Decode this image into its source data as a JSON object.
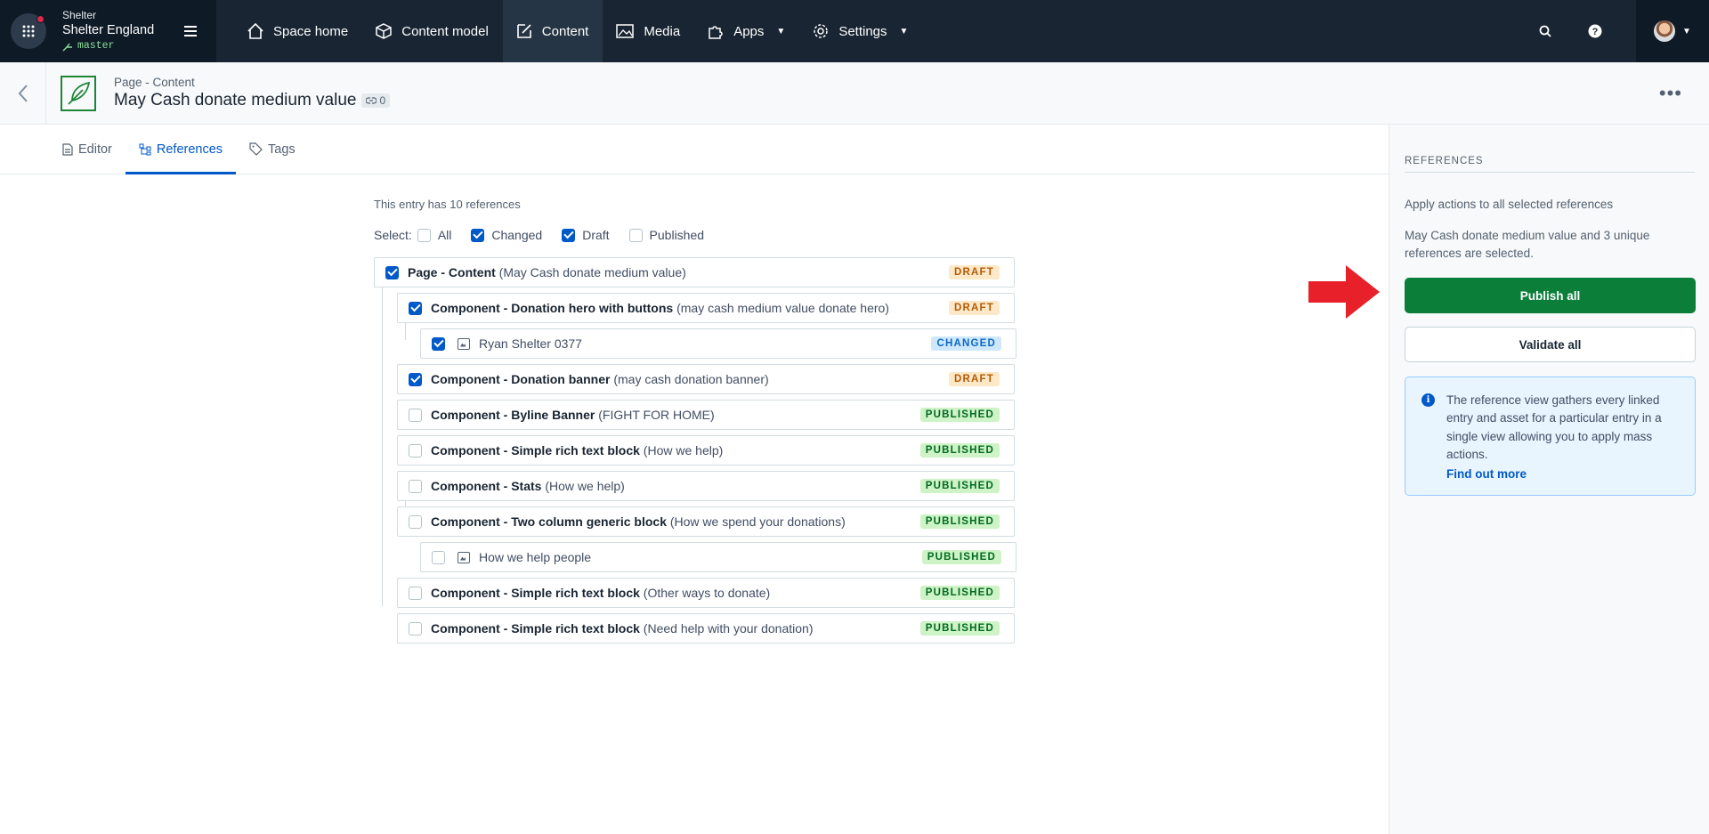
{
  "topnav": {
    "org": "Shelter",
    "space_name": "Shelter England",
    "environment": "master",
    "items": [
      {
        "label": "Space home",
        "icon": "home-icon"
      },
      {
        "label": "Content model",
        "icon": "cube-icon"
      },
      {
        "label": "Content",
        "icon": "pencil-icon",
        "active": true
      },
      {
        "label": "Media",
        "icon": "image-icon"
      },
      {
        "label": "Apps",
        "icon": "puzzle-icon",
        "dropdown": true
      },
      {
        "label": "Settings",
        "icon": "gear-icon",
        "dropdown": true
      }
    ]
  },
  "entry": {
    "type": "Page - Content",
    "title": "May Cash donate medium value",
    "link_count": "0"
  },
  "tabs": [
    {
      "label": "Editor",
      "icon": "document-icon"
    },
    {
      "label": "References",
      "icon": "references-icon",
      "active": true
    },
    {
      "label": "Tags",
      "icon": "tag-icon"
    }
  ],
  "references": {
    "summary": "This entry has 10 references",
    "select_label": "Select:",
    "select_options": [
      {
        "label": "All",
        "checked": false
      },
      {
        "label": "Changed",
        "checked": true
      },
      {
        "label": "Draft",
        "checked": true
      },
      {
        "label": "Published",
        "checked": false
      }
    ],
    "rows": [
      {
        "title": "Page - Content",
        "sub": " (May Cash donate medium value)",
        "status": "DRAFT",
        "checked": true,
        "level": 0
      },
      {
        "title": "Component - Donation hero with buttons",
        "sub": " (may cash medium value donate hero)",
        "status": "DRAFT",
        "checked": true,
        "level": 1
      },
      {
        "title": "",
        "sub": "Ryan Shelter 0377",
        "status": "CHANGED",
        "checked": true,
        "level": 2,
        "asset": true
      },
      {
        "title": "Component - Donation banner",
        "sub": " (may cash donation banner)",
        "status": "DRAFT",
        "checked": true,
        "level": 1
      },
      {
        "title": "Component - Byline Banner",
        "sub": " (FIGHT FOR HOME)",
        "status": "PUBLISHED",
        "checked": false,
        "level": 1
      },
      {
        "title": "Component - Simple rich text block",
        "sub": " (How we help)",
        "status": "PUBLISHED",
        "checked": false,
        "level": 1
      },
      {
        "title": "Component - Stats",
        "sub": " (How we help)",
        "status": "PUBLISHED",
        "checked": false,
        "level": 1
      },
      {
        "title": "Component - Two column generic block",
        "sub": " (How we spend your donations)",
        "status": "PUBLISHED",
        "checked": false,
        "level": 1
      },
      {
        "title": "",
        "sub": "How we help people",
        "status": "PUBLISHED",
        "checked": false,
        "level": 2,
        "asset": true
      },
      {
        "title": "Component - Simple rich text block",
        "sub": " (Other ways to donate)",
        "status": "PUBLISHED",
        "checked": false,
        "level": 1
      },
      {
        "title": "Component - Simple rich text block",
        "sub": " (Need help with your donation)",
        "status": "PUBLISHED",
        "checked": false,
        "level": 1
      }
    ]
  },
  "sidebar": {
    "title": "REFERENCES",
    "apply_text": "Apply actions to all selected references",
    "selected_text": "May Cash donate medium value and 3 unique references are selected.",
    "publish_label": "Publish all",
    "validate_label": "Validate all",
    "info_text": "The reference view gathers every linked entry and asset for a particular entry in a single view allowing you to apply mass actions.",
    "info_link": "Find out more"
  },
  "colors": {
    "nav_bg": "#192532",
    "primary": "#0059c8",
    "publish_green": "#0b7f3a",
    "annotation_arrow": "#e8202a"
  }
}
